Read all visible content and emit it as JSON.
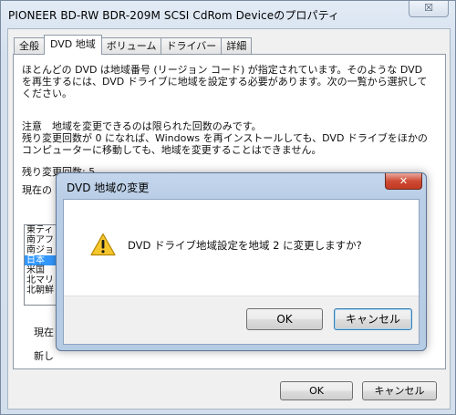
{
  "window": {
    "title": "PIONEER BD-RW   BDR-209M SCSI CdRom Deviceのプロパティ",
    "close_symbol": "☒"
  },
  "tabs": [
    {
      "label": "全般"
    },
    {
      "label": "DVD 地域"
    },
    {
      "label": "ボリューム"
    },
    {
      "label": "ドライバー"
    },
    {
      "label": "詳細"
    }
  ],
  "panel": {
    "paragraph1": "ほとんどの DVD は地域番号 (リージョン コード) が指定されています。そのような DVD を再生するには、DVD ドライブに地域を設定する必要があります。次の一覧から選択してください。",
    "paragraph2": "注意　地域を変更できるのは限られた回数のみです。\n残り変更回数が 0 になれば、Windows を再インストールしても、DVD ドライブをほかのコンピューターに移動しても、地域を変更することはできません。",
    "remaining_label": "残り変更回数: 5",
    "current_label": "現在の",
    "region_list": [
      "東ティ",
      "南アフ",
      "南ジョ",
      "日本",
      "米国",
      "北マリ",
      "北朝鮮"
    ],
    "selected_region": "日本",
    "current_region_label": "現在",
    "new_region_label": "新し"
  },
  "buttons": {
    "ok": "OK",
    "cancel": "キャンセル"
  },
  "dialog": {
    "title": "DVD 地域の変更",
    "close_symbol": "✕",
    "message": "DVD ドライブ地域設定を地域 2 に変更しますか?",
    "ok": "OK",
    "cancel": "キャンセル",
    "icon": "warning-icon"
  }
}
